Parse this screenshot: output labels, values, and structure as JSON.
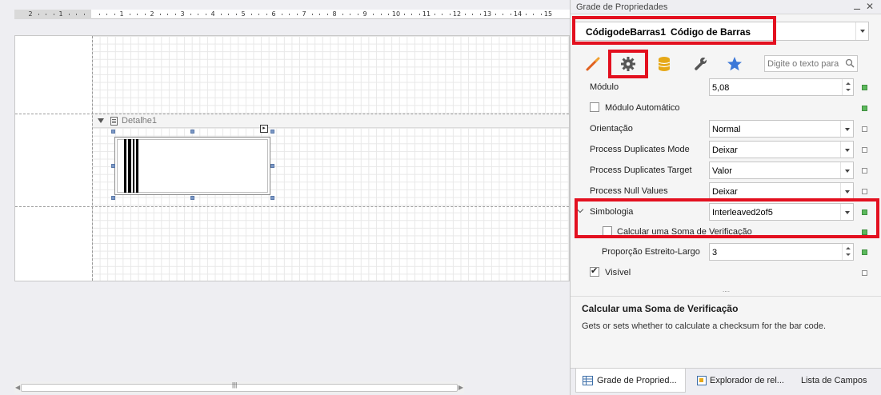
{
  "ruler": {
    "labels": [
      "2",
      "1",
      "1",
      "2",
      "3",
      "4",
      "5",
      "6",
      "7",
      "8",
      "9",
      "10",
      "11",
      "12",
      "13",
      "14",
      "15"
    ]
  },
  "band": {
    "label": "Detalhe1"
  },
  "panel": {
    "title": "Grade de Propriedades",
    "object_name": "CódigodeBarras1",
    "object_type": "Código de Barras",
    "search_placeholder": "Digite o texto para pesquisar",
    "tool_icons": [
      "brush-icon",
      "gear-icon",
      "database-icon",
      "wrench-icon",
      "star-icon"
    ],
    "properties": [
      {
        "label": "Módulo",
        "value": "5,08",
        "kind": "spin",
        "mark": "set"
      },
      {
        "label": "Módulo Automático",
        "kind": "checkbox",
        "checked": false,
        "mark": "set"
      },
      {
        "label": "Orientação",
        "value": "Normal",
        "kind": "dropdown",
        "mark": "default"
      },
      {
        "label": "Process Duplicates Mode",
        "value": "Deixar",
        "kind": "dropdown",
        "mark": "default"
      },
      {
        "label": "Process Duplicates Target",
        "value": "Valor",
        "kind": "dropdown",
        "mark": "default"
      },
      {
        "label": "Process Null Values",
        "value": "Deixar",
        "kind": "dropdown",
        "mark": "default"
      },
      {
        "label": "Simbologia",
        "value": "Interleaved2of5",
        "kind": "dropdown",
        "mark": "set",
        "expanded": true
      },
      {
        "label": "Calcular uma Soma de Verificação",
        "kind": "checkbox",
        "checked": false,
        "mark": "set",
        "child": true
      },
      {
        "label": "Proporção Estreito-Largo",
        "value": "3",
        "kind": "spin",
        "mark": "set",
        "child": true
      },
      {
        "label": "Visível",
        "kind": "checkbox",
        "checked": true,
        "mark": "default"
      }
    ],
    "description": {
      "title": "Calcular uma Soma de Verificação",
      "text": "Gets or sets whether to calculate a checksum for the bar code."
    },
    "tabs": [
      "Grade de Propried...",
      "Explorador de rel...",
      "Lista de Campos"
    ]
  },
  "colors": {
    "highlight": "#e3101f",
    "set_mark": "#5cb85c",
    "icon_blue": "#3c78d8",
    "icon_gold": "#e6a817"
  }
}
